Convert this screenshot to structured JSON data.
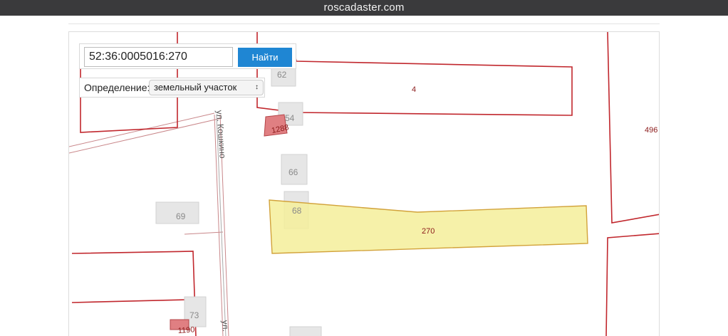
{
  "browser": {
    "url_title": "roscadaster.com"
  },
  "search": {
    "value": "52:36:0005016:270",
    "button_label": "Найти"
  },
  "definition": {
    "label": "Определение:",
    "selected": "земельный участок"
  },
  "map": {
    "highlight_color": "#f5ef9a",
    "boundary_color": "#c1272d",
    "parcel_labels": {
      "p4": "4",
      "p270": "270",
      "p1288": "1288",
      "p1190": "1190",
      "p496": "496"
    },
    "building_numbers": {
      "b62": "62",
      "b54": "54",
      "b66": "66",
      "b68": "68",
      "b69": "69",
      "b73": "73"
    },
    "streets": {
      "koshkino_1": "ул. Кошкино",
      "koshkino_2": "ул."
    }
  }
}
